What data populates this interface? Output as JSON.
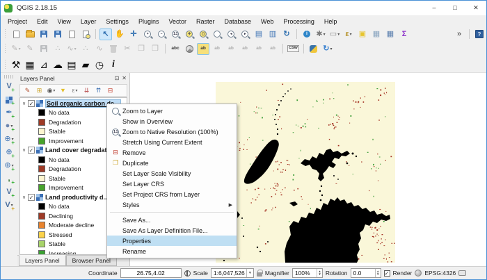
{
  "window": {
    "title": "QGIS 2.18.15",
    "minimize": "–",
    "maximize": "□",
    "close": "✕"
  },
  "menubar": [
    "Project",
    "Edit",
    "View",
    "Layer",
    "Settings",
    "Plugins",
    "Vector",
    "Raster",
    "Database",
    "Web",
    "Processing",
    "Help"
  ],
  "toolbar_row1": [
    {
      "name": "new-project-icon",
      "css": "page"
    },
    {
      "name": "open-project-icon",
      "css": "folder"
    },
    {
      "name": "save-project-icon",
      "css": "floppy"
    },
    {
      "name": "save-project-as-icon",
      "css": "floppy"
    },
    {
      "name": "new-composer-icon",
      "css": "page"
    },
    {
      "name": "composer-manager-icon",
      "css": "pagemag"
    },
    {
      "sep": true
    },
    {
      "name": "touch-pan-icon",
      "glyph": "↖",
      "color": "#2f6fb0",
      "bold": true,
      "active": true
    },
    {
      "name": "pan-map-icon",
      "glyph": "✋",
      "color": "#b5a592"
    },
    {
      "name": "pan-to-selection-icon",
      "glyph": "✛",
      "color": "#2f6fb0",
      "bold": true
    },
    {
      "name": "zoom-in-icon",
      "mag": "+"
    },
    {
      "name": "zoom-out-icon",
      "mag": "−"
    },
    {
      "name": "zoom-native-icon",
      "mag": "1:1"
    },
    {
      "name": "zoom-full-icon",
      "mag": "✛",
      "fill": true
    },
    {
      "name": "zoom-to-selection-icon",
      "mag": "▢",
      "fill": true
    },
    {
      "name": "zoom-to-layer-icon",
      "mag": ""
    },
    {
      "name": "zoom-last-icon",
      "mag": "◂"
    },
    {
      "name": "zoom-next-icon",
      "mag": "▸"
    },
    {
      "name": "new-bookmark-icon",
      "glyph": "▤",
      "color": "#3f74b5"
    },
    {
      "name": "show-bookmarks-icon",
      "glyph": "▥",
      "color": "#3f74b5"
    },
    {
      "name": "refresh-icon",
      "glyph": "↻",
      "color": "#2f6fb0",
      "bold": true
    },
    {
      "sep": true
    },
    {
      "name": "identify-features-icon",
      "css": "ident"
    },
    {
      "name": "feature-actions-icon",
      "glyph": "✱",
      "color": "#7a7a7a",
      "dd": true
    },
    {
      "name": "select-features-icon",
      "glyph": "▭",
      "color": "#888888",
      "dd": true
    },
    {
      "name": "select-by-expression-icon",
      "glyph": "ε",
      "color": "#b5912a",
      "bold": true,
      "dd": true
    },
    {
      "name": "deselect-all-icon",
      "glyph": "▣",
      "color": "#e7c52f"
    },
    {
      "name": "open-attribute-table-icon",
      "glyph": "▦",
      "color": "#8aa5c0"
    },
    {
      "name": "field-calculator-icon",
      "glyph": "▦",
      "color": "#5b7fae"
    },
    {
      "name": "statistics-icon",
      "glyph": "Σ",
      "color": "#8b2fc9",
      "bold": true
    },
    {
      "name": "toolbar-overflow-button",
      "glyph": "»",
      "color": "#333333",
      "spacer": true
    },
    {
      "sep": true
    },
    {
      "name": "help-icon",
      "css": "help"
    }
  ],
  "toolbar_row2": [
    {
      "name": "current-edits-icon",
      "glyph": "✎",
      "color": "#7a5230",
      "disabled": true,
      "dd": true
    },
    {
      "name": "toggle-editing-icon",
      "glyph": "✎",
      "color": "#7a5230",
      "disabled": true
    },
    {
      "name": "save-layer-edits-icon",
      "css": "floppy",
      "disabled": true
    },
    {
      "name": "add-feature-icon",
      "glyph": "∴",
      "color": "#356e35",
      "disabled": true
    },
    {
      "name": "node-tool-icon",
      "glyph": "∿",
      "color": "#555555",
      "disabled": true,
      "dd": true
    },
    {
      "name": "move-feature-icon",
      "glyph": "∴",
      "color": "#356e35",
      "disabled": true
    },
    {
      "name": "delete-part-icon",
      "glyph": "∿",
      "color": "#884444",
      "disabled": true
    },
    {
      "name": "delete-selected-icon",
      "css": "trash",
      "disabled": true
    },
    {
      "name": "cut-features-icon",
      "glyph": "✂",
      "color": "#444444",
      "disabled": true
    },
    {
      "name": "copy-features-icon",
      "glyph": "❐",
      "color": "#666666",
      "disabled": true
    },
    {
      "name": "paste-features-icon",
      "glyph": "❒",
      "color": "#666666",
      "disabled": true
    },
    {
      "sep": true
    },
    {
      "name": "label-toolbar-icon",
      "glyph": "abc",
      "text": true,
      "color": "#333333"
    },
    {
      "name": "diagram-options-icon",
      "css": "pie"
    },
    {
      "name": "highlight-labels-icon",
      "glyph": "ab",
      "text": true,
      "color": "#333333",
      "yellow": true
    },
    {
      "name": "pin-labels-icon",
      "glyph": "ab",
      "text": true,
      "color": "#333333",
      "disabled": true
    },
    {
      "name": "show-hide-labels-icon",
      "glyph": "ab",
      "text": true,
      "color": "#333333",
      "disabled": true
    },
    {
      "name": "move-label-icon",
      "glyph": "ab",
      "text": true,
      "color": "#333333",
      "disabled": true
    },
    {
      "name": "rotate-label-icon",
      "glyph": "ab",
      "text": true,
      "color": "#333333",
      "disabled": true
    },
    {
      "name": "change-label-icon",
      "glyph": "ab",
      "text": true,
      "color": "#333333",
      "disabled": true
    },
    {
      "sep": true
    },
    {
      "name": "csw-search-icon",
      "glyph": "CSW",
      "boxed": true
    },
    {
      "sep": true
    },
    {
      "name": "python-console-icon",
      "css": "python"
    },
    {
      "name": "plugin-reload-icon",
      "glyph": "↻",
      "color": "#3b82d0",
      "bold": true,
      "dd": true
    }
  ],
  "toolbar_row3": [
    {
      "name": "settings-wrench-icon",
      "glyph": "⚒"
    },
    {
      "name": "calculate-indicator-icon",
      "glyph": "▦"
    },
    {
      "name": "timeseries-plot-icon",
      "glyph": "⊿"
    },
    {
      "name": "download-data-icon",
      "glyph": "☁"
    },
    {
      "name": "reporting-icon",
      "glyph": "▤"
    },
    {
      "name": "load-data-icon",
      "glyph": "▰"
    },
    {
      "name": "visualization-icon",
      "glyph": "◷"
    },
    {
      "name": "about-plugin-icon",
      "glyph": "i",
      "serif": true
    }
  ],
  "left_toolbar": [
    {
      "name": "add-vector-layer-icon",
      "glyph": "V",
      "color": "#4a6e9e",
      "bold": true,
      "plus": true
    },
    {
      "name": "add-raster-layer-icon",
      "css": "rastersm",
      "plus": true
    },
    {
      "name": "add-spatialite-layer-icon",
      "glyph": "✒",
      "color": "#3f74b5",
      "plus": true
    },
    {
      "name": "add-postgis-layer-icon",
      "glyph": "●",
      "color": "#6c86b0",
      "plus": true,
      "dd": true
    },
    {
      "name": "add-wms-layer-icon",
      "glyph": "⊕",
      "color": "#3f74b5",
      "plus": true,
      "dd": true
    },
    {
      "name": "add-wcs-layer-icon",
      "glyph": "⊕",
      "color": "#3f74b5",
      "plus": true
    },
    {
      "name": "add-wfs-layer-icon",
      "glyph": "⊕",
      "color": "#3f74b5",
      "plus": true,
      "dd": true
    },
    {
      "name": "add-delimited-text-icon",
      "glyph": ",",
      "color": "#2a6e2a",
      "bold": true,
      "plus": true
    },
    {
      "name": "new-shapefile-icon",
      "glyph": "V",
      "color": "#4a6e9e",
      "bold": true,
      "plus": true
    },
    {
      "name": "new-layer-icon",
      "glyph": "V",
      "color": "#4a6e9e",
      "bold": true,
      "plusy": true,
      "dd": true
    }
  ],
  "layers_panel": {
    "title": "Layers Panel",
    "float_button": "⊡",
    "close_button": "✕",
    "toolbar": [
      {
        "name": "open-styling-dock-icon",
        "glyph": "✎",
        "color": "#b04a2a"
      },
      {
        "name": "add-group-icon",
        "glyph": "⊞",
        "color": "#caa227"
      },
      {
        "name": "manage-themes-icon",
        "glyph": "◉",
        "color": "#555555",
        "dd": true
      },
      {
        "name": "filter-legend-icon",
        "glyph": "▼",
        "color": "#e3bf2c"
      },
      {
        "name": "filter-expression-icon",
        "glyph": "ε",
        "color": "#888888",
        "dd": true
      },
      {
        "name": "expand-all-icon",
        "glyph": "⇊",
        "color": "#b03a3a"
      },
      {
        "name": "collapse-all-icon",
        "glyph": "⇈",
        "color": "#3a6eb0"
      },
      {
        "name": "remove-layer-icon",
        "glyph": "⊟",
        "color": "#c23a2a"
      }
    ],
    "expander": "∨",
    "checkmark": "✓",
    "layers": [
      {
        "name": "Soil organic carbon de...",
        "selected": true,
        "legend": [
          {
            "label": "No data",
            "color": "#000000"
          },
          {
            "label": "Degradation",
            "color": "#9e3a26"
          },
          {
            "label": "Stable",
            "color": "#fdf5d0"
          },
          {
            "label": "Improvement",
            "color": "#47a32b"
          }
        ]
      },
      {
        "name": "Land cover degradat...",
        "selected": false,
        "legend": [
          {
            "label": "No data",
            "color": "#000000"
          },
          {
            "label": "Degradation",
            "color": "#9e3a26"
          },
          {
            "label": "Stable",
            "color": "#fdf5d0"
          },
          {
            "label": "Improvement",
            "color": "#47a32b"
          }
        ]
      },
      {
        "name": "Land productivity d...",
        "selected": false,
        "legend": [
          {
            "label": "No data",
            "color": "#000000"
          },
          {
            "label": "Declining",
            "color": "#9e3a26"
          },
          {
            "label": "Moderate decline",
            "color": "#e8842f"
          },
          {
            "label": "Stressed",
            "color": "#fcd24a"
          },
          {
            "label": "Stable",
            "color": "#a8d46a"
          },
          {
            "label": "Increasing",
            "color": "#3aa032"
          }
        ]
      }
    ],
    "tabs": [
      {
        "label": "Layers Panel",
        "active": true
      },
      {
        "label": "Browser Panel",
        "active": false
      }
    ]
  },
  "context_menu": {
    "items": [
      {
        "label": "Zoom to Layer",
        "icon": "mag"
      },
      {
        "label": "Show in Overview"
      },
      {
        "label": "Zoom to Native Resolution (100%)",
        "icon": "mag100"
      },
      {
        "label": "Stretch Using Current Extent"
      },
      {
        "label": "Remove",
        "icon": "remove"
      },
      {
        "label": "Duplicate",
        "icon": "duplicate"
      },
      {
        "label": "Set Layer Scale Visibility"
      },
      {
        "label": "Set Layer CRS"
      },
      {
        "label": "Set Project CRS from Layer"
      },
      {
        "label": "Styles",
        "submenu": true,
        "separator_after": true
      },
      {
        "label": "Save As..."
      },
      {
        "label": "Save As Layer Definition File..."
      },
      {
        "label": "Properties",
        "highlighted": true
      },
      {
        "label": "Rename"
      }
    ]
  },
  "map": {
    "background": "#faf7d9",
    "black": "#000000",
    "speckle_red": "#a33022",
    "speckle_green": "#3f9e3a",
    "blobs": [
      "M86,83 C90,84 92,88 90,94 C88,101 84,110 78,120 C72,130 64,138 55,144 C49,147 43,148 41,144 C40,140 44,132 50,123 C57,112 64,101 71,93 C76,87 81,82 86,83 Z",
      "M122,117 L128,111 L135,113 L139,107 L145,110 L149,102 L155,105 L159,98 L165,96 L169,101 L175,99 L181,103 L189,99 L193,103 L187,107 L181,106 L177,111 L171,109 L167,115 L173,119 L169,124 L163,121 L159,127 L154,132 L156,138 L151,143 L147,139 L149,132 L145,127 L139,125 L135,119 L129,121 Z",
      "M100,260 L99,244 L102,232 L108,220 L106,208 L112,200 L119,203 L123,194 L130,196 L134,188 L141,190 L145,181 L151,184 L155,174 L161,177 L165,168 L171,171 L175,166 L179,171 L185,169 L189,175 L195,173 L199,179 L205,177 L211,183 L216,181 L222,187 L228,185 L232,191 L239,189 L245,193 L250,191 L251,197 L245,200 L238,198 L232,203 L226,201 L221,207 L215,205 L212,213 L207,217 L209,225 L205,233 L207,241 L203,249 L205,256 L203,260 Z",
      "M14,190 L22,184 L31,186 L35,191 L30,197 L21,199 L15,196 Z",
      "M106,174 L114,172 L118,176 L112,179 Z"
    ],
    "dots": [
      [
        97,
        21,
        1
      ],
      [
        94,
        27,
        1
      ],
      [
        91,
        33,
        1
      ],
      [
        88,
        40,
        1.1
      ],
      [
        86,
        47,
        1
      ],
      [
        85,
        54,
        1
      ],
      [
        87,
        61,
        1
      ],
      [
        89,
        68,
        1.1
      ],
      [
        89,
        75,
        1.2
      ],
      [
        100,
        17,
        0.9
      ],
      [
        104,
        13,
        0.9
      ],
      [
        108,
        10,
        0.8
      ],
      [
        152,
        150,
        1.2
      ],
      [
        150,
        157,
        1.2
      ],
      [
        153,
        163,
        1.2
      ],
      [
        151,
        170,
        1.3
      ],
      [
        197,
        103,
        1.5
      ],
      [
        202,
        107,
        1.2
      ],
      [
        189,
        117,
        1.3
      ],
      [
        8,
        186,
        1.2
      ],
      [
        11,
        200,
        1.1
      ],
      [
        38,
        196,
        1
      ],
      [
        60,
        238,
        1.2
      ],
      [
        64,
        244,
        1.1
      ],
      [
        40,
        222,
        1
      ],
      [
        5,
        252,
        1.2
      ],
      [
        12,
        257,
        1.1
      ],
      [
        120,
        245,
        1.3
      ],
      [
        116,
        252,
        1.1
      ],
      [
        75,
        230,
        1
      ],
      [
        170,
        135,
        1
      ],
      [
        176,
        140,
        0.9
      ]
    ]
  },
  "statusbar": {
    "coordinate_label": "Coordinate",
    "coordinate_value": "26.75,4.02",
    "scale_label": "Scale",
    "scale_value": "1:6,047,526",
    "magnifier_label": "Magnifier",
    "magnifier_value": "100%",
    "rotation_label": "Rotation",
    "rotation_value": "0.0",
    "render_label": "Render",
    "epsg_label": "EPSG:4326"
  }
}
